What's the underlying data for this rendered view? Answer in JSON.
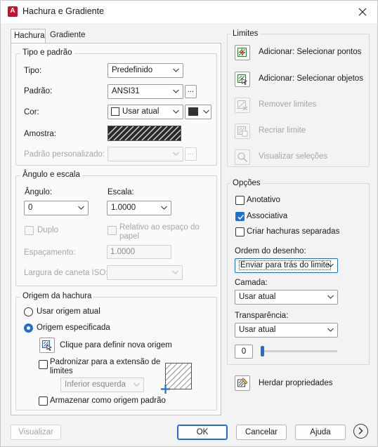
{
  "window": {
    "title": "Hachura e Gradiente",
    "app_icon_letter": "A"
  },
  "tabs": [
    {
      "label": "Hachura"
    },
    {
      "label": "Gradiente"
    }
  ],
  "tipo_padrao": {
    "title": "Tipo e padrão",
    "tipo_label": "Tipo:",
    "tipo_value": "Predefinido",
    "padrao_label": "Padrão:",
    "padrao_value": "ANSI31",
    "padrao_more": "...",
    "cor_label": "Cor:",
    "cor_value": "Usar atual",
    "amostra_label": "Amostra:",
    "personalizado_label": "Padrão personalizado:",
    "personalizado_more": "..."
  },
  "angulo_escala": {
    "title": "Ângulo e escala",
    "angulo_label": "Ângulo:",
    "angulo_value": "0",
    "escala_label": "Escala:",
    "escala_value": "1.0000",
    "duplo_label": "Duplo",
    "relativo_label_1": "Relativo ao espaço do",
    "relativo_label_2": "papel",
    "espacamento_label": "Espaçamento:",
    "espacamento_value": "1.0000",
    "largura_label": "Largura de caneta ISO:"
  },
  "origem": {
    "title": "Origem da hachura",
    "usar_atual_label": "Usar origem atual",
    "especificada_label": "Origem especificada",
    "clique_label": "Clique para definir nova origem",
    "padronizar_label_1": "Padronizar para a extensão de",
    "padronizar_label_2": "limites",
    "inferior_value": "Inferior esquerda",
    "armazenar_label": "Armazenar como origem padrão"
  },
  "limites": {
    "title": "Limites",
    "adicionar_pontos": "Adicionar: Selecionar pontos",
    "adicionar_objetos": "Adicionar: Selecionar objetos",
    "remover": "Remover limites",
    "recriar": "Recriar limite",
    "visualizar": "Visualizar seleções"
  },
  "opcoes": {
    "title": "Opções",
    "anotativo": "Anotativo",
    "associativa": "Associativa",
    "criar_separadas": "Criar hachuras separadas",
    "ordem_label": "Ordem do desenho:",
    "ordem_value": "Enviar para trás do limite",
    "camada_label": "Camada:",
    "camada_value": "Usar atual",
    "transparencia_label": "Transparência:",
    "transparencia_select": "Usar atual",
    "transparencia_value": "0",
    "transparencia_slider": 0
  },
  "herdar": "Herdar propriedades",
  "footer": {
    "visualizar": "Visualizar",
    "ok": "OK",
    "cancelar": "Cancelar",
    "ajuda": "Ajuda",
    "more_icon": "chevron-right-circle-icon"
  },
  "colors": {
    "accent": "#1f6fd1",
    "app_icon": "#c8102e"
  }
}
